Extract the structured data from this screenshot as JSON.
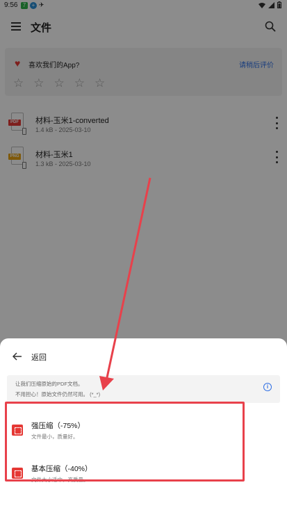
{
  "status_bar": {
    "time": "9:56"
  },
  "app_bar": {
    "title": "文件"
  },
  "rating_card": {
    "question": "喜欢我们的App?",
    "action": "请稍后评价",
    "stars_rating": 0,
    "stars_total": 5
  },
  "files": [
    {
      "name": "材料-玉米1-converted",
      "meta": "1.4 kB - 2025-03-10",
      "type_label": "PDF",
      "type_color": "#e53935"
    },
    {
      "name": "材料-玉米1",
      "meta": "1.3 kB - 2025-03-10",
      "type_label": "PNG",
      "type_color": "#e7a313"
    }
  ],
  "sheet": {
    "back_label": "返回",
    "info_line1": "让我们压缩原始的PDF文档。",
    "info_line2": "不用担心！原始文件仍然可用。 (*_*)",
    "options": [
      {
        "title": "强压缩（-75%）",
        "subtitle": "文件最小，质量好。"
      },
      {
        "title": "基本压缩（-40%）",
        "subtitle": "文件大小适中，高质量。"
      }
    ]
  },
  "colors": {
    "accent": "#2f6fe4",
    "danger": "#e53935",
    "annotation": "#e8414b"
  }
}
